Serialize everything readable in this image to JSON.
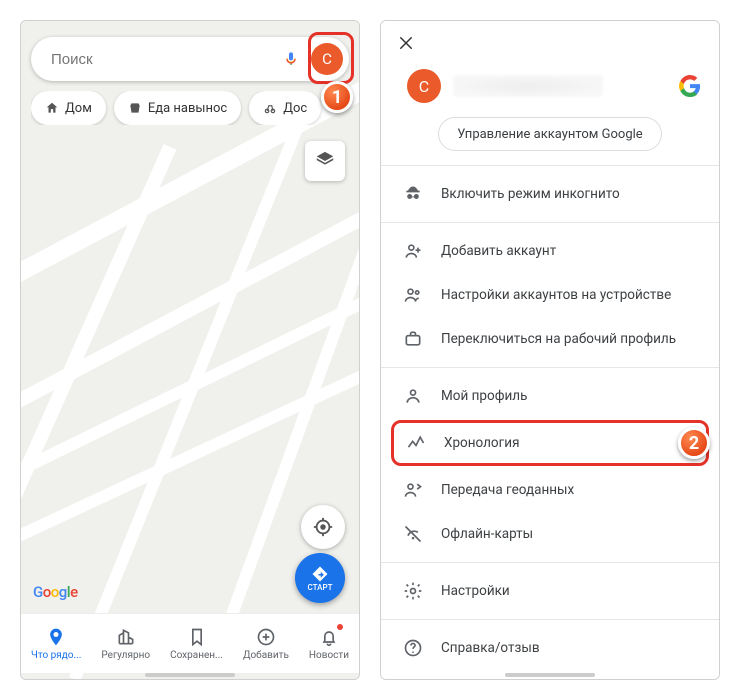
{
  "left": {
    "search_placeholder": "Поиск",
    "avatar_letter": "C",
    "chips": [
      "Дом",
      "Еда навынос",
      "Дос"
    ],
    "start_label": "СТАРТ",
    "logo_letters": [
      "G",
      "o",
      "o",
      "g",
      "l",
      "e"
    ],
    "nav": [
      {
        "label": "Что рядо...",
        "active": true
      },
      {
        "label": "Регулярно"
      },
      {
        "label": "Сохранен..."
      },
      {
        "label": "Добавить"
      },
      {
        "label": "Новости",
        "badge": true
      }
    ],
    "callout_1": "1"
  },
  "right": {
    "avatar_letter": "C",
    "manage_label": "Управление аккаунтом Google",
    "menu_groups": [
      [
        "Включить режим инкогнито"
      ],
      [
        "Добавить аккаунт",
        "Настройки аккаунтов на устройстве",
        "Переключиться на рабочий профиль"
      ],
      [
        "Мой профиль",
        "Хронология",
        "Передача геоданных",
        "Офлайн-карты"
      ],
      [
        "Настройки"
      ],
      [
        "Справка/отзыв"
      ]
    ],
    "callout_2": "2"
  }
}
